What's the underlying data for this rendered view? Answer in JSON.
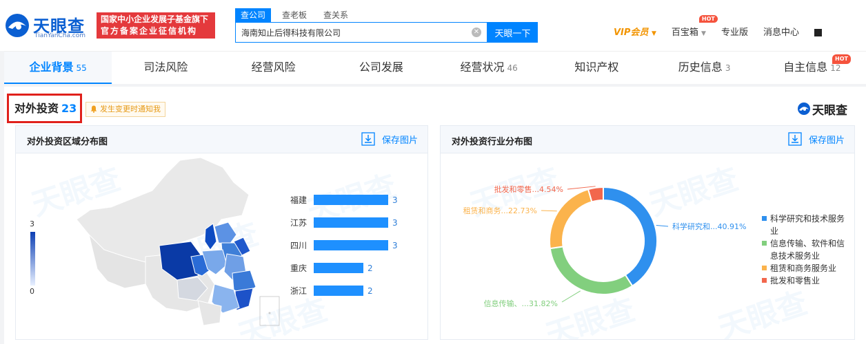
{
  "header": {
    "logo_text": "天眼查",
    "logo_sub": "TianYanCha.com",
    "banner_line1": "国家中小企业发展子基金旗下",
    "banner_line2": "官方备案企业征信机构",
    "search_tabs": [
      "查公司",
      "查老板",
      "查关系"
    ],
    "search_value": "海南知止后得科技有限公司",
    "search_button": "天眼一下",
    "vip_label": "VIP会员",
    "baobaoxiang": "百宝箱",
    "hot": "HOT",
    "pro": "专业版",
    "messages": "消息中心"
  },
  "tabs": [
    {
      "label": "企业背景",
      "count": "55"
    },
    {
      "label": "司法风险",
      "count": ""
    },
    {
      "label": "经营风险",
      "count": ""
    },
    {
      "label": "公司发展",
      "count": ""
    },
    {
      "label": "经营状况",
      "count": "46"
    },
    {
      "label": "知识产权",
      "count": ""
    },
    {
      "label": "历史信息",
      "count": "3"
    },
    {
      "label": "自主信息",
      "count": "12"
    }
  ],
  "section": {
    "title": "对外投资",
    "count": "23",
    "notify": "发生变更时通知我",
    "brand": "天眼查"
  },
  "region_panel": {
    "title": "对外投资区域分布图",
    "save": "保存图片",
    "scale_max": "3",
    "scale_min": "0"
  },
  "industry_panel": {
    "title": "对外投资行业分布图",
    "save": "保存图片"
  },
  "colors": {
    "accent": "#0084ff",
    "bar": "#1e90ff",
    "sci": "#2f90ee",
    "info": "#82cf7e",
    "lease": "#fbb34c",
    "retail": "#f2674d"
  },
  "chart_data": [
    {
      "type": "bar",
      "title": "对外投资区域分布图",
      "categories": [
        "福建",
        "江苏",
        "四川",
        "重庆",
        "浙江"
      ],
      "values": [
        3,
        3,
        3,
        2,
        2
      ],
      "xlim": [
        0,
        3
      ]
    },
    {
      "type": "pie",
      "title": "对外投资行业分布图",
      "slices": [
        {
          "legend": "科学研究和技术服务业",
          "label": "科学研究和...40.91%",
          "value": 40.91
        },
        {
          "legend": "信息传输、软件和信息技术服务业",
          "label": "信息传输、...31.82%",
          "value": 31.82
        },
        {
          "legend": "租赁和商务服务业",
          "label": "租赁和商务...22.73%",
          "value": 22.73
        },
        {
          "legend": "批发和零售业",
          "label": "批发和零售...4.54%",
          "value": 4.54
        }
      ]
    }
  ]
}
